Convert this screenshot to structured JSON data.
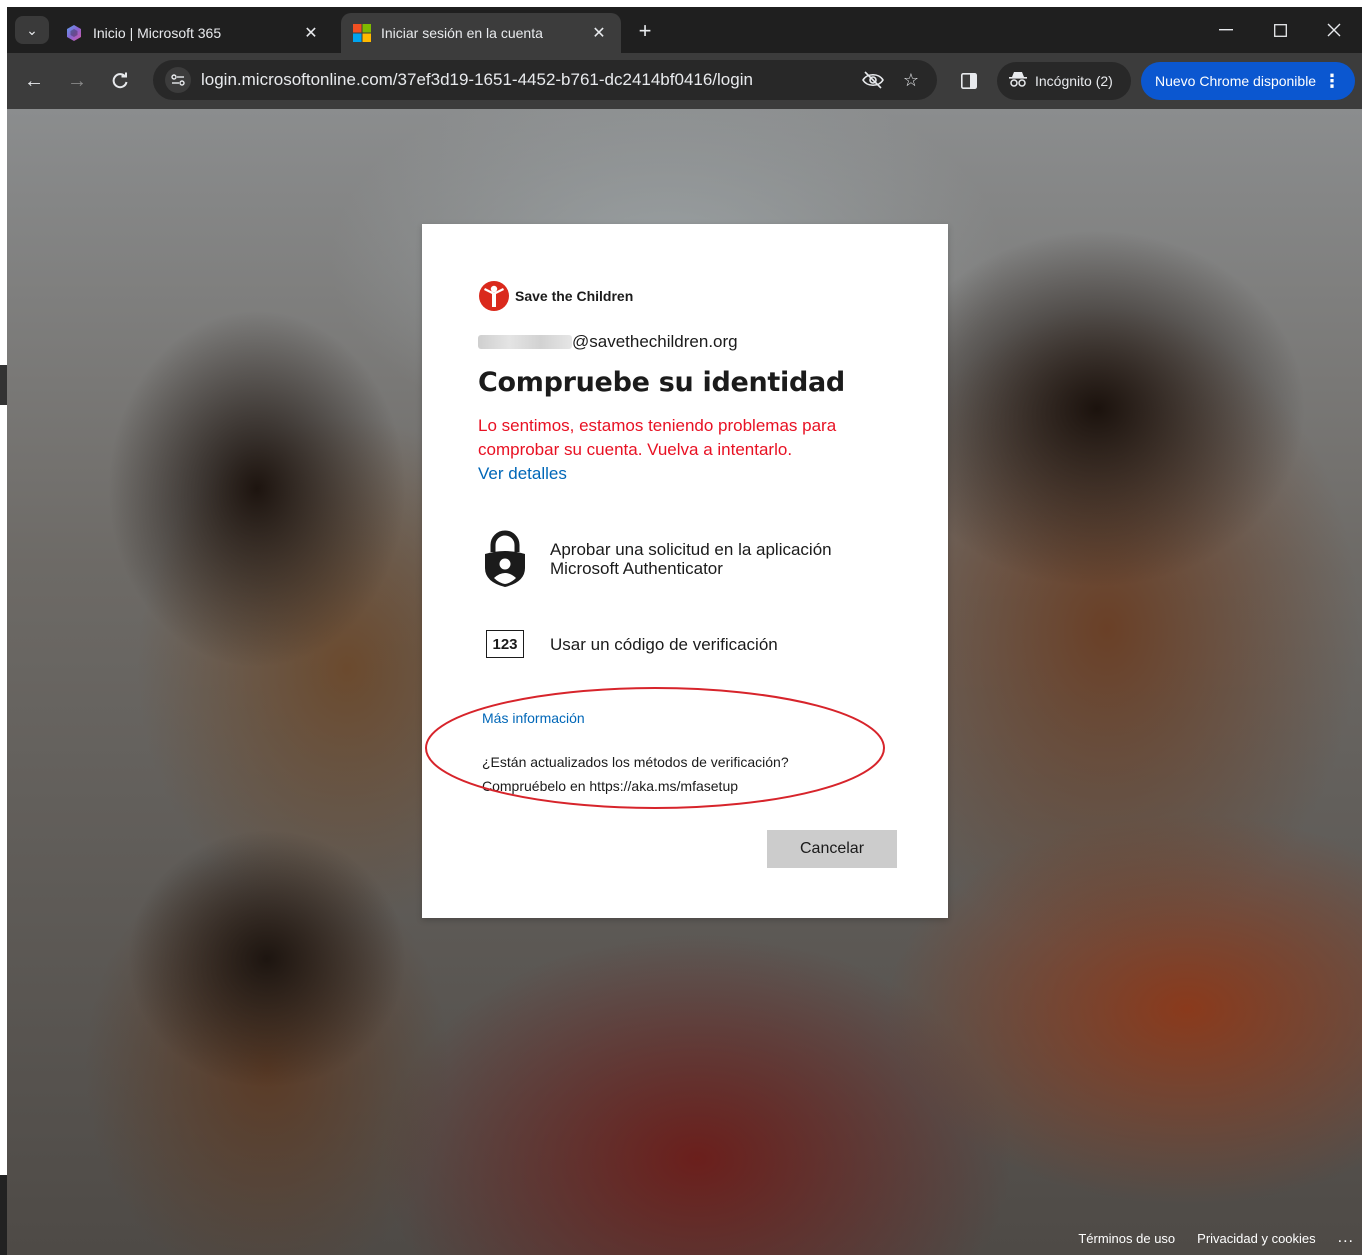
{
  "browser": {
    "tabs": [
      {
        "title": "Inicio | Microsoft 365",
        "active": false
      },
      {
        "title": "Iniciar sesión en la cuenta",
        "active": true
      }
    ],
    "url": "login.microsoftonline.com/37ef3d19-1651-4452-b761-dc2414bf0416/login",
    "incognito_label": "Incógnito (2)",
    "update_label": "Nuevo Chrome disponible",
    "accent_color": "#0b57d0"
  },
  "signin": {
    "brand_name": "Save the Children",
    "account_suffix": "@savethechildren.org",
    "heading": "Compruebe su identidad",
    "error_line1": "Lo sentimos, estamos teniendo problemas para",
    "error_line2": "comprobar su cuenta. Vuelva a intentarlo.",
    "details_link": "Ver detalles",
    "options": [
      {
        "icon": "authenticator-lock-icon",
        "line1": "Aprobar una solicitud en la aplicación",
        "line2": "Microsoft Authenticator"
      },
      {
        "icon": "code-123-icon",
        "icon_text": "123",
        "line1": "Usar un código de verificación"
      }
    ],
    "more_info_link": "Más información",
    "methods_line1": "¿Están actualizados los métodos de verificación?",
    "methods_line2": "Compruébelo en https://aka.ms/mfasetup",
    "cancel_label": "Cancelar",
    "error_color": "#e81123",
    "link_color": "#0067b8"
  },
  "footer": {
    "terms": "Términos de uso",
    "privacy": "Privacidad y cookies",
    "more": "..."
  }
}
